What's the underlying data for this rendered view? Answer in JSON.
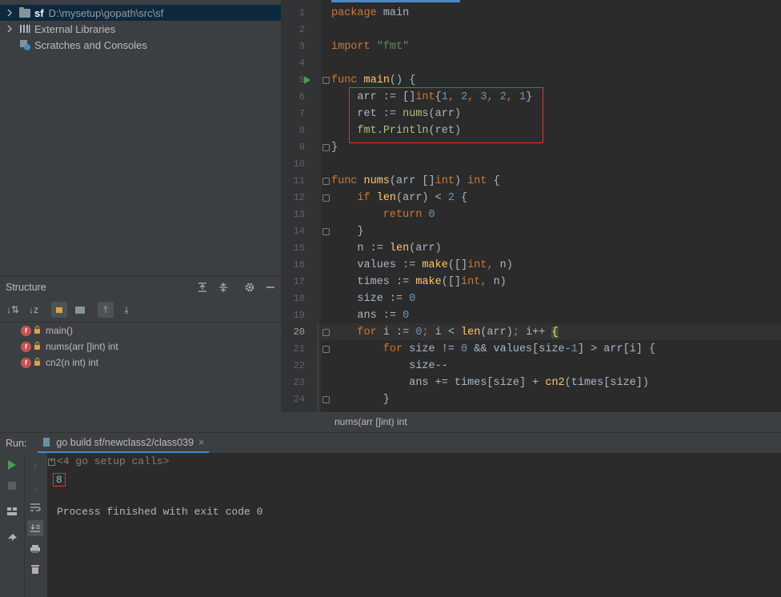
{
  "project": {
    "root_name": "sf",
    "root_path": "D:\\mysetup\\gopath\\src\\sf",
    "external_libraries": "External Libraries",
    "scratches": "Scratches and Consoles"
  },
  "structure": {
    "title": "Structure",
    "members": [
      {
        "icon": "f",
        "label": "main()"
      },
      {
        "icon": "f",
        "label": "nums(arr []int) int"
      },
      {
        "icon": "f",
        "label": "cn2(n int) int"
      }
    ]
  },
  "editor": {
    "line_numbers": [
      "1",
      "2",
      "3",
      "4",
      "5",
      "6",
      "7",
      "8",
      "9",
      "10",
      "11",
      "12",
      "13",
      "14",
      "15",
      "16",
      "17",
      "18",
      "19",
      "20",
      "21",
      "22",
      "23",
      "24"
    ],
    "current_line": "20",
    "breadcrumb": "nums(arr []int) int"
  },
  "run": {
    "label": "Run:",
    "tab": "go build sf/newclass2/class039",
    "tab_close": "×",
    "setup_calls": "<4 go setup calls>",
    "output_value": "8",
    "finished": "Process finished with exit code 0"
  },
  "colors": {
    "keyword": "#cc7832",
    "function": "#ffc66d",
    "string": "#6a8759",
    "number": "#6897bb",
    "highlight_box": "#e0352b",
    "run_arrow": "#499c54"
  }
}
